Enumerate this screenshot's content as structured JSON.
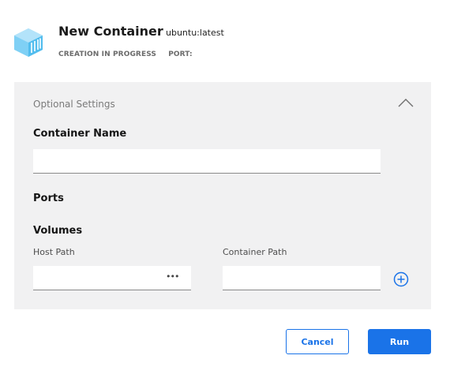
{
  "header": {
    "icon": "container-icon",
    "title": "New Container",
    "image": "ubuntu:latest",
    "status": "CREATION IN PROGRESS",
    "port_label": "PORT:"
  },
  "panel": {
    "title": "Optional Settings",
    "collapse_icon": "chevron-up-icon",
    "container_name_label": "Container Name",
    "container_name_value": "",
    "ports_label": "Ports",
    "volumes_label": "Volumes",
    "host_path_label": "Host Path",
    "host_path_value": "",
    "browse_label": "•••",
    "container_path_label": "Container Path",
    "container_path_value": "",
    "add_icon": "plus-circle-icon"
  },
  "actions": {
    "cancel_label": "Cancel",
    "run_label": "Run"
  },
  "colors": {
    "accent": "#1a73e8",
    "panel_bg": "#f1f1f2",
    "logo": "#5cc3f0"
  }
}
